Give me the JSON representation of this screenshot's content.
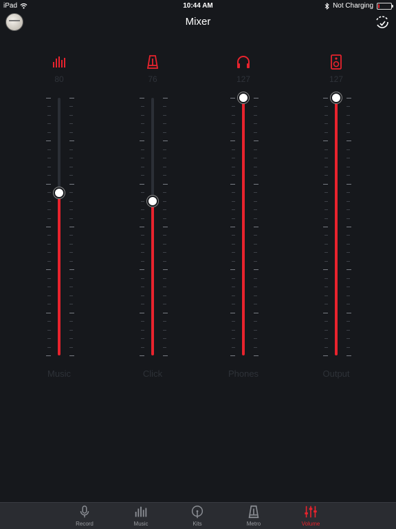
{
  "status": {
    "device": "iPad",
    "time": "10:44 AM",
    "charging": "Not Charging"
  },
  "nav": {
    "title": "Mixer"
  },
  "accent": "#e8232d",
  "channels": [
    {
      "label": "Music",
      "value": "80",
      "level": 0.63,
      "icon": "bars-icon"
    },
    {
      "label": "Click",
      "value": "76",
      "level": 0.6,
      "icon": "metronome-icon"
    },
    {
      "label": "Phones",
      "value": "127",
      "level": 1.0,
      "icon": "headphones-icon"
    },
    {
      "label": "Output",
      "value": "127",
      "level": 1.0,
      "icon": "speaker-icon"
    }
  ],
  "tabs": [
    {
      "label": "Record",
      "icon": "microphone-icon",
      "active": false
    },
    {
      "label": "Music",
      "icon": "bars-icon",
      "active": false
    },
    {
      "label": "Kits",
      "icon": "drumstick-icon",
      "active": false
    },
    {
      "label": "Metro",
      "icon": "metronome-icon",
      "active": false
    },
    {
      "label": "Volume",
      "icon": "sliders-icon",
      "active": true
    }
  ]
}
